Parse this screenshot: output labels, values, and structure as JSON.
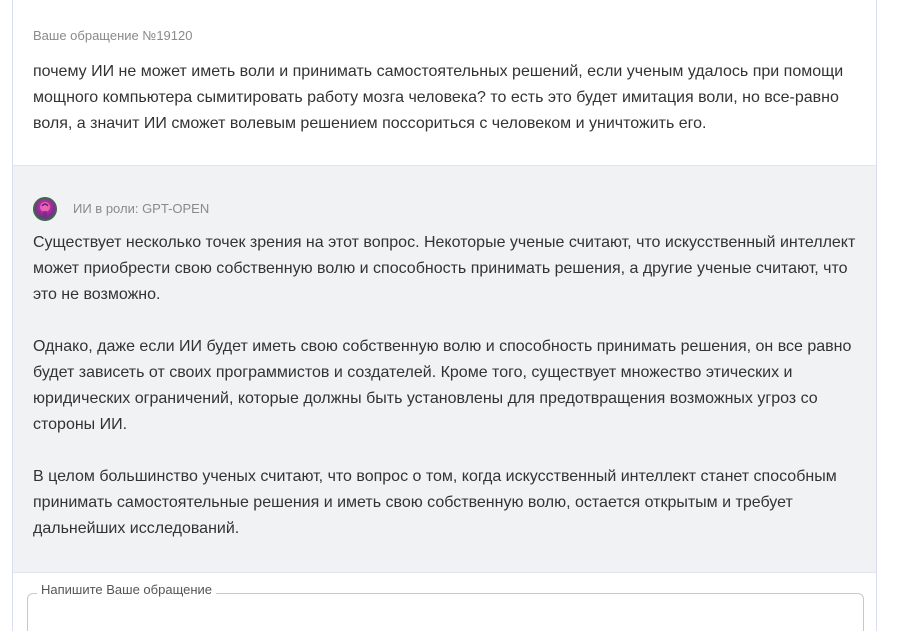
{
  "question": {
    "label": "Ваше обращение №19120",
    "text": "почему ИИ не может иметь воли и принимать самостоятельных решений, если ученым удалось при помощи мощного компьютера сымитировать работу мозга человека? то есть это будет имитация воли, но все-равно воля, а значит ИИ сможет волевым решением поссориться с человеком и уничтожить его."
  },
  "answer": {
    "avatar_icon": "ai-avatar-icon",
    "role_label": "ИИ в роли: GPT-OPEN",
    "paragraphs": [
      "Существует несколько точек зрения на этот вопрос. Некоторые ученые считают, что искусственный интеллект может приобрести свою собственную волю и способность принимать решения, а другие ученые считают, что это не возможно.",
      "Однако, даже если ИИ будет иметь свою собственную волю и способность принимать решения, он все равно будет зависеть от своих программистов и создателей. Кроме того, существует множество этических и юридических ограничений, которые должны быть установлены для предотвращения возможных угроз со стороны ИИ.",
      "В целом большинство ученых считают, что вопрос о том, когда искусственный интеллект станет способным принимать самостоятельные решения и иметь свою собственную волю, остается открытым и требует дальнейших исследований."
    ]
  },
  "input": {
    "label": "Напишите Ваше обращение",
    "value": ""
  },
  "colors": {
    "answer_background": "#f1f2f4",
    "card_border": "#d9dcf5",
    "text": "#333333",
    "muted_text": "#8a8a8a"
  }
}
